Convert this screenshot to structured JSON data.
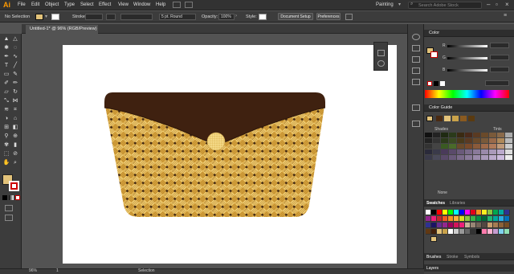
{
  "app": {
    "logo": "Ai"
  },
  "menu": {
    "items": [
      "File",
      "Edit",
      "Object",
      "Type",
      "Select",
      "Effect",
      "View",
      "Window",
      "Help"
    ]
  },
  "workspace": "Painting",
  "search": {
    "placeholder": "Search Adobe Stock"
  },
  "control_bar": {
    "selection_label": "No Selection",
    "stroke_label": "Stroke:",
    "brush_value": "5 pt. Round",
    "opacity_label": "Opacity:",
    "opacity_value": "100%",
    "style_label": "Style:",
    "doc_setup": "Document Setup",
    "preferences": "Preferences"
  },
  "document_tab": {
    "label": "Untitled-1* @ 96% (RGB/Preview)",
    "close": "×"
  },
  "status": {
    "zoom": "96%",
    "page": "1",
    "tool": "Selection"
  },
  "color_panel": {
    "title": "Color",
    "channels": [
      "R",
      "G",
      "B"
    ]
  },
  "color_guide": {
    "title": "Color Guide",
    "left_label": "Shades",
    "right_label": "Tints",
    "none_label": "None"
  },
  "swatches": {
    "tabs": [
      "Swatches",
      "Libraries"
    ]
  },
  "bottom_tabs": [
    "Brushes",
    "Stroke",
    "Symbols"
  ],
  "layers": {
    "title": "Layers"
  },
  "colors": {
    "accent": "#ff9a00",
    "flap": "#3f2110",
    "weave_light": "#f2d27a",
    "weave_mid": "#d9a640",
    "weave_dark": "#7a5422"
  }
}
